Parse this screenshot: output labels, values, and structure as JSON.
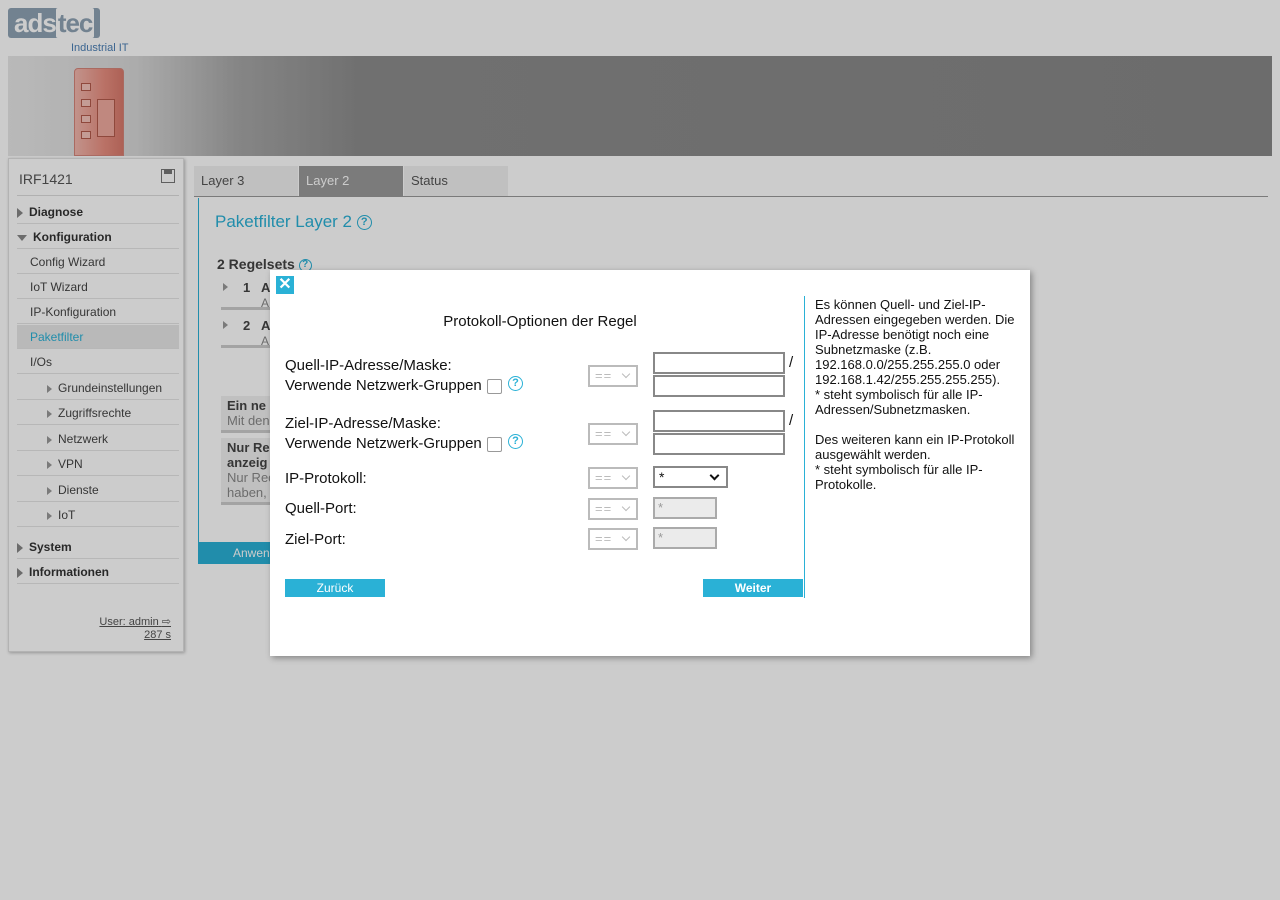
{
  "header": {
    "logo_text_a": "ads",
    "logo_text_b": "tec",
    "logo_sub": "Industrial IT"
  },
  "sidebar": {
    "device_name": "IRF1421",
    "items": [
      {
        "label": "Diagnose"
      },
      {
        "label": "Konfiguration"
      },
      {
        "label": "Config Wizard"
      },
      {
        "label": "IoT Wizard"
      },
      {
        "label": "IP-Konfiguration"
      },
      {
        "label": "Paketfilter"
      },
      {
        "label": "I/Os"
      },
      {
        "label": "Grundeinstellungen"
      },
      {
        "label": "Zugriffsrechte"
      },
      {
        "label": "Netzwerk"
      },
      {
        "label": "VPN"
      },
      {
        "label": "Dienste"
      },
      {
        "label": "IoT"
      },
      {
        "label": "System"
      },
      {
        "label": "Informationen"
      }
    ],
    "user": "User: admin",
    "timer": "287 s"
  },
  "tabs": [
    {
      "label": "Layer 3"
    },
    {
      "label": "Layer 2"
    },
    {
      "label": "Status"
    }
  ],
  "main": {
    "title": "Paketfilter Layer 2",
    "rulesets_title": "2 Regelsets",
    "rows": [
      {
        "num": "1",
        "a": "A",
        "b": "A"
      },
      {
        "num": "2",
        "a": "A",
        "b": "A"
      }
    ],
    "info1_line1": "Ein ne",
    "info1_line2": "Mit den",
    "info2_line1": "Nur Re",
    "info2_line2": "anzeig",
    "info2_line3": "Nur Rec",
    "info2_line4": "haben,",
    "apply_label": "Anwen",
    "help_glyph": "?"
  },
  "modal": {
    "close_glyph": "✕",
    "title": "Protokoll-Optionen der Regel",
    "source_label": "Quell-IP-Adresse/Maske:",
    "source_groups_label": "Verwende Netzwerk-Gruppen",
    "target_label": "Ziel-IP-Adresse/Maske:",
    "target_groups_label": "Verwende Netzwerk-Gruppen",
    "protocol_label": "IP-Protokoll:",
    "src_port_label": "Quell-Port:",
    "dst_port_label": "Ziel-Port:",
    "operator": "==",
    "slash": "/",
    "protocol_value": "*",
    "src_port_value": "*",
    "dst_port_value": "*",
    "back_label": "Zurück",
    "next_label": "Weiter",
    "help_p1": "Es können Quell- und Ziel-IP-Adressen eingegeben werden. Die IP-Adresse benötigt noch eine Subnetzmaske (z.B. 192.168.0.0/255.255.255.0 oder 192.168.1.42/255.255.255.255).",
    "help_p1b": "* steht symbolisch für alle IP-Adressen/Subnetzmasken.",
    "help_p2": "Des weiteren kann ein IP-Protokoll ausgewählt werden.",
    "help_p2b": "* steht symbolisch für alle IP-Protokolle."
  },
  "colors": {
    "accent": "#2ab1d6",
    "overlay": "rgba(0,0,0,0.2)"
  }
}
